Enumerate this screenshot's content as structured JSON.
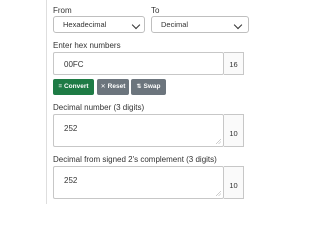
{
  "from": {
    "label": "From",
    "selected": "Hexadecimal"
  },
  "to": {
    "label": "To",
    "selected": "Decimal"
  },
  "hex_input": {
    "label": "Enter hex numbers",
    "value": "00FC",
    "base": "16"
  },
  "buttons": {
    "convert": "Convert",
    "reset": "Reset",
    "swap": "Swap"
  },
  "decimal_result": {
    "label": "Decimal number (3 digits)",
    "value": "252",
    "base": "10"
  },
  "twos_result": {
    "label": "Decimal from signed 2's complement (3 digits)",
    "value": "252",
    "base": "10"
  },
  "colors": {
    "convert": "#1e7b45",
    "secondary": "#6c757d"
  }
}
